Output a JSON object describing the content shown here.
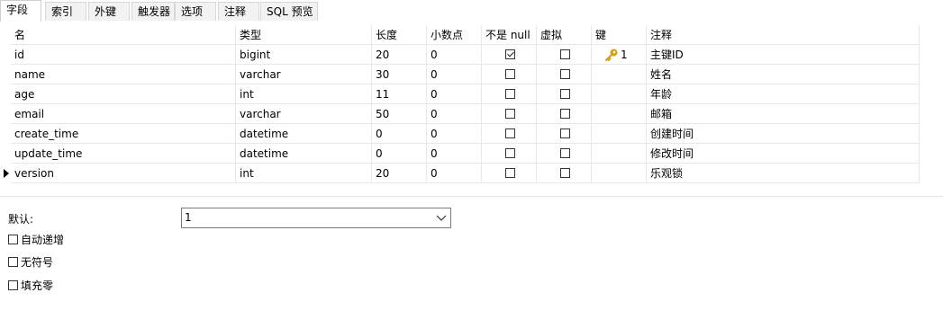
{
  "tabs": [
    "字段",
    "索引",
    "外键",
    "触发器",
    "选项",
    "注释",
    "SQL 预览"
  ],
  "active_tab": "字段",
  "columns": [
    "名",
    "类型",
    "长度",
    "小数点",
    "不是 null",
    "虚拟",
    "键",
    "注释"
  ],
  "rows": [
    {
      "name": "id",
      "type": "bigint",
      "length": "20",
      "decimals": "0",
      "not_null": true,
      "virtual": false,
      "key": "1",
      "comment": "主键ID"
    },
    {
      "name": "name",
      "type": "varchar",
      "length": "30",
      "decimals": "0",
      "not_null": false,
      "virtual": false,
      "key": "",
      "comment": "姓名"
    },
    {
      "name": "age",
      "type": "int",
      "length": "11",
      "decimals": "0",
      "not_null": false,
      "virtual": false,
      "key": "",
      "comment": "年龄"
    },
    {
      "name": "email",
      "type": "varchar",
      "length": "50",
      "decimals": "0",
      "not_null": false,
      "virtual": false,
      "key": "",
      "comment": "邮箱"
    },
    {
      "name": "create_time",
      "type": "datetime",
      "length": "0",
      "decimals": "0",
      "not_null": false,
      "virtual": false,
      "key": "",
      "comment": "创建时间"
    },
    {
      "name": "update_time",
      "type": "datetime",
      "length": "0",
      "decimals": "0",
      "not_null": false,
      "virtual": false,
      "key": "",
      "comment": "修改时间"
    },
    {
      "name": "version",
      "type": "int",
      "length": "20",
      "decimals": "0",
      "not_null": false,
      "virtual": false,
      "key": "",
      "comment": "乐观锁",
      "current": true
    }
  ],
  "properties": {
    "default_label": "默认:",
    "default_value": "1",
    "options": [
      {
        "label": "自动递增",
        "checked": false
      },
      {
        "label": "无符号",
        "checked": false
      },
      {
        "label": "填充零",
        "checked": false
      }
    ]
  },
  "key_icon": "key-icon",
  "key_color": "#d4a017"
}
